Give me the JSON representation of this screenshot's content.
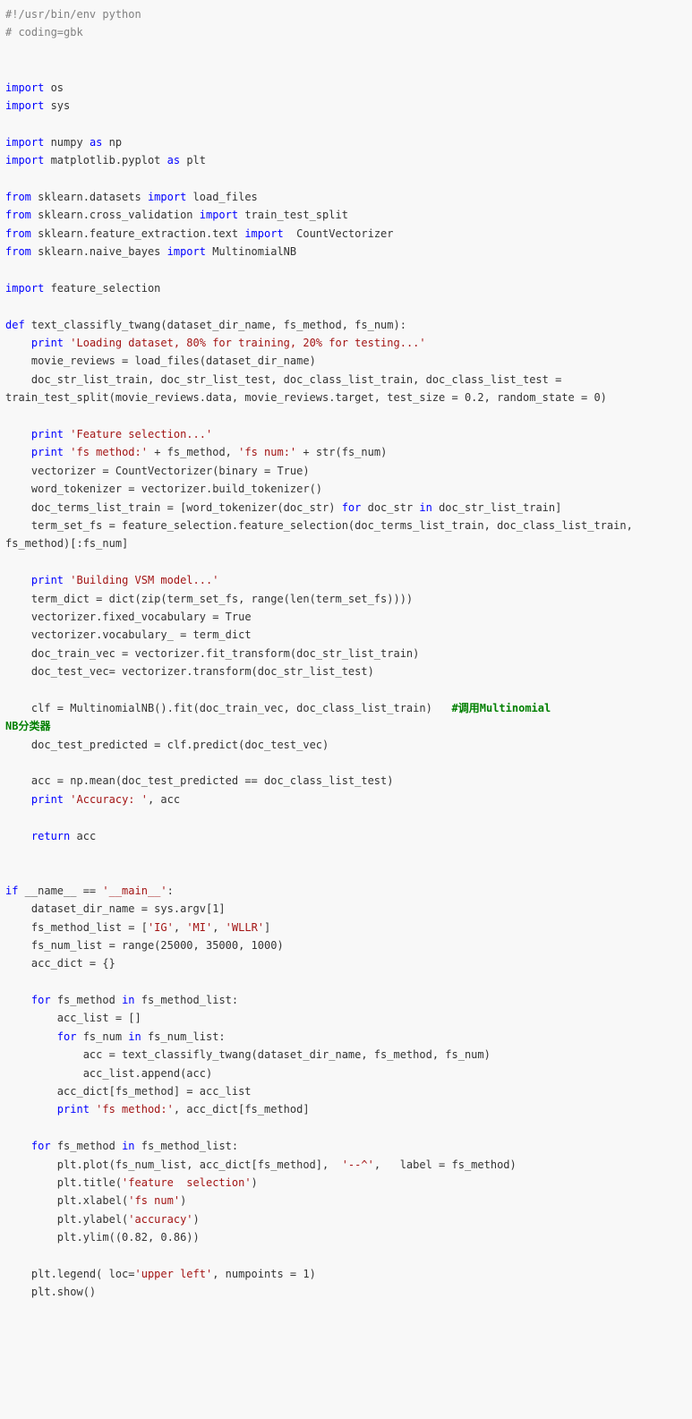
{
  "code": {
    "t01": "#!/usr/bin/env python",
    "t02": "# coding=gbk",
    "k_import": "import",
    "k_from": "from",
    "k_as": "as",
    "k_def": "def",
    "k_for": "for",
    "k_in": "in",
    "k_return": "return",
    "k_if": "if",
    "k_print": "print",
    "m_os": " os",
    "m_sys": " sys",
    "m_np": " numpy ",
    "m_np2": " np",
    "m_plt": " matplotlib.pyplot ",
    "m_plt2": " plt",
    "m_ds": " sklearn.datasets ",
    "m_ds2": " load_files",
    "m_cv": " sklearn.cross_validation ",
    "m_cv2": " train_test_split",
    "m_fe": " sklearn.feature_extraction.text ",
    "m_fe2": "  CountVectorizer",
    "m_nb": " sklearn.naive_bayes ",
    "m_nb2": " MultinomialNB",
    "m_fs": " feature_selection",
    "def1": " text_classifly_twang(dataset_dir_name, fs_method, fs_num):",
    "s_load": "'Loading dataset, 80% for training, 20% for testing...'",
    "l_mr": "    movie_reviews = load_files(dataset_dir_name)",
    "l_split": "    doc_str_list_train, doc_str_list_test, doc_class_list_train, doc_class_list_test = train_test_split(movie_reviews.data, movie_reviews.target, test_size = 0.2, random_state = 0)",
    "s_fs": "'Feature selection...'",
    "s_fm": "'fs method:'",
    "s_fn": "'fs num:'",
    "l_pfs": " + fs_method, ",
    "l_pfn": " + str(fs_num)",
    "l_vec": "    vectorizer = CountVectorizer(binary = True)",
    "l_tok": "    word_tokenizer = vectorizer.build_tokenizer()",
    "l_dt1": "    doc_terms_list_train = [word_tokenizer(doc_str) ",
    "l_dt2": " doc_str ",
    "l_dt3": " doc_str_list_train]",
    "l_tsf": "    term_set_fs = feature_selection.feature_selection(doc_terms_list_train, doc_class_list_train, fs_method)[:fs_num]",
    "s_vsm": "'Building VSM model...'",
    "l_td": "    term_dict = dict(zip(term_set_fs, range(len(term_set_fs))))",
    "l_fv": "    vectorizer.fixed_vocabulary = True",
    "l_voc": "    vectorizer.vocabulary_ = term_dict",
    "l_trv": "    doc_train_vec = vectorizer.fit_transform(doc_str_list_train)",
    "l_tev": "    doc_test_vec= vectorizer.transform(doc_str_list_test)",
    "l_clf": "    clf = MultinomialNB().fit(doc_train_vec, doc_class_list_train)   ",
    "c_clf1": "#调用Multinomial",
    "c_clf2": "NB分类器",
    "l_pred": "    doc_test_predicted = clf.predict(doc_test_vec)",
    "l_acc": "    acc = np.mean(doc_test_predicted == doc_class_list_test)",
    "s_acc": "'Accuracy: '",
    "l_acc2": ", acc",
    "l_ret": " acc",
    "l_if": " __name__ == ",
    "s_main": "'__main__'",
    "l_if2": ":",
    "l_ddn": "    dataset_dir_name = sys.argv[1]",
    "l_fml1": "    fs_method_list = [",
    "s_ig": "'IG'",
    "s_mi": "'MI'",
    "s_wllr": "'WLLR'",
    "l_fml2": ", ",
    "l_fml3": "]",
    "l_fnl": "    fs_num_list = range(25000, 35000, 1000)",
    "l_ad": "    acc_dict = {}",
    "l_for1a": " fs_method ",
    "l_for1b": " fs_method_list:",
    "l_al": "        acc_list = []",
    "l_for2a": " fs_num ",
    "l_for2b": " fs_num_list:",
    "l_call": "            acc = text_classifly_twang(dataset_dir_name, fs_method, fs_num)",
    "l_app": "            acc_list.append(acc)",
    "l_ad2": "        acc_dict[fs_method] = acc_list",
    "s_pm": "'fs method:'",
    "l_pm2": ", acc_dict[fs_method]",
    "l_plot1": "        plt.plot(fs_num_list, acc_dict[fs_method],  ",
    "s_marker": "'--^'",
    "l_plot2": ",   label = fs_method)",
    "l_title": "        plt.title(",
    "s_title": "'feature  selection'",
    "l_close": ")",
    "l_xl": "        plt.xlabel(",
    "s_xl": "'fs num'",
    "l_yl": "        plt.ylabel(",
    "s_yl": "'accuracy'",
    "l_ylim": "        plt.ylim((0.82, 0.86))",
    "l_leg": "    plt.legend( loc=",
    "s_ul": "'upper left'",
    "l_leg2": ", numpoints = 1)",
    "l_show": "    plt.show()",
    "sp4": "    ",
    "sp8": "        "
  }
}
